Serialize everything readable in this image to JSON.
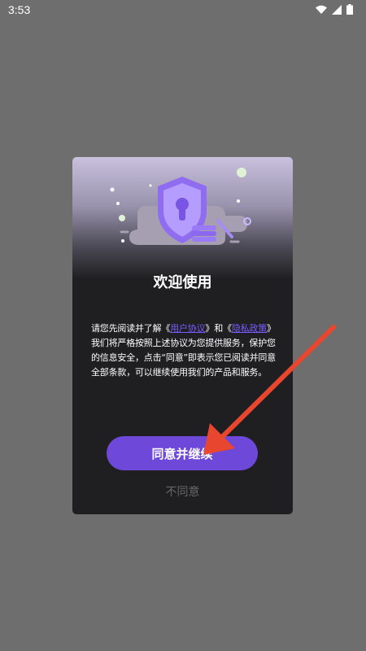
{
  "status_bar": {
    "time": "3:53",
    "icons": [
      "wifi-icon",
      "signal-icon",
      "battery-icon"
    ]
  },
  "dialog": {
    "title": "欢迎使用",
    "body_prefix": "请您先阅读并了解《",
    "link1": "用户协议",
    "body_mid": "》和《",
    "link2": "隐私政策",
    "body_suffix": "》我们将严格按照上述协议为您提供服务，保护您的信息安全，点击“同意”即表示您已阅读并同意全部条款，可以继续使用我们的产品和服务。",
    "agree_label": "同意并继续",
    "disagree_label": "不同意"
  },
  "colors": {
    "accent": "#6e48d8",
    "link": "#7b5cff",
    "annotation_arrow": "#e8462e"
  }
}
